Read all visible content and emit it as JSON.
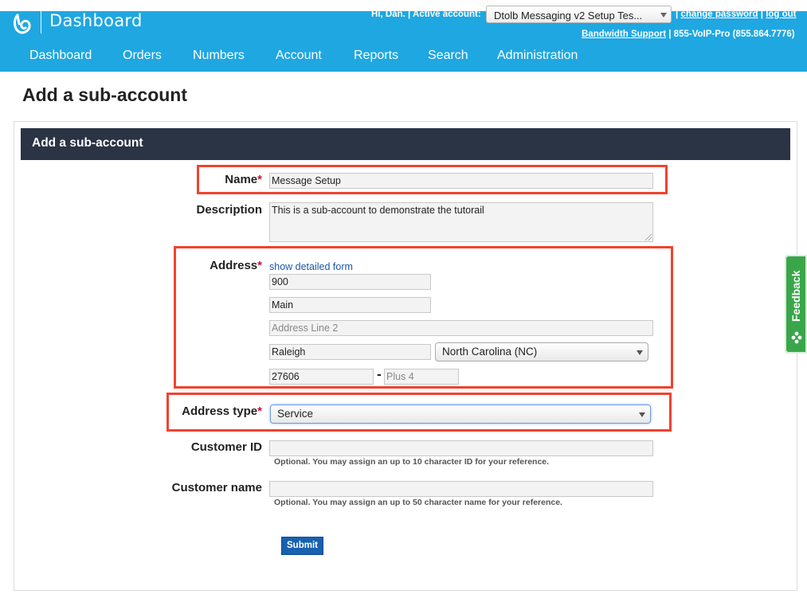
{
  "header": {
    "brand": "Dashboard",
    "greeting": "Hi, Dan.",
    "active_account_label": "Active account:",
    "active_account_value": "Dtolb Messaging v2 Setup Tes...",
    "change_password": "change password",
    "log_out": "log out",
    "support_link": "Bandwidth Support",
    "support_phone": "855-VoIP-Pro (855.864.7776)",
    "separator": "|"
  },
  "nav": {
    "items": [
      "Dashboard",
      "Orders",
      "Numbers",
      "Account",
      "Reports",
      "Search",
      "Administration"
    ]
  },
  "page": {
    "title": "Add a sub-account",
    "panel_title": "Add a sub-account"
  },
  "form": {
    "name": {
      "label": "Name",
      "required_mark": "*",
      "value": "Message Setup"
    },
    "description": {
      "label": "Description",
      "value": "This is a sub-account to demonstrate the tutorail"
    },
    "address": {
      "label": "Address",
      "required_mark": "*",
      "detail_link": "show detailed form",
      "house_number": "900",
      "street": "Main",
      "line2_placeholder": "Address Line 2",
      "city": "Raleigh",
      "state": "North Carolina (NC)",
      "zip": "27606",
      "dash": "-",
      "plus4_placeholder": "Plus 4"
    },
    "address_type": {
      "label": "Address type",
      "required_mark": "*",
      "value": "Service"
    },
    "customer_id": {
      "label": "Customer ID",
      "hint": "Optional. You may assign an up to 10 character ID for your reference."
    },
    "customer_name": {
      "label": "Customer name",
      "hint": "Optional. You may assign an up to 50 character name for your reference."
    },
    "submit_label": "Submit"
  },
  "feedback": {
    "label": "Feedback"
  },
  "colors": {
    "header_blue": "#1fa7e1",
    "panel_head": "#2b3445",
    "highlight": "#f2422f",
    "required": "#c0143c",
    "submit": "#1860b0",
    "feedback": "#3aa64a"
  }
}
